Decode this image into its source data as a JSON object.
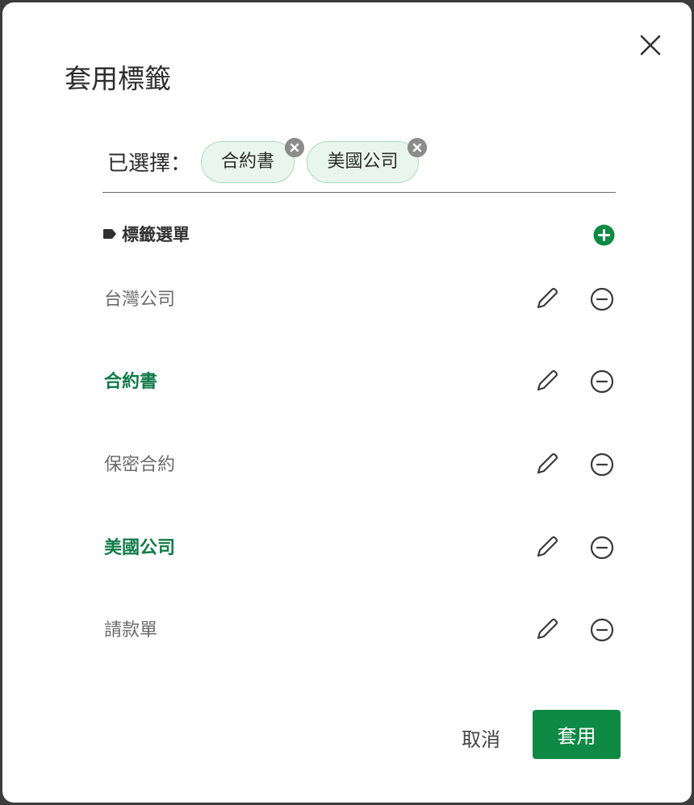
{
  "dialog": {
    "title": "套用標籤",
    "close_icon": "close-icon"
  },
  "selected": {
    "label": "已選擇：",
    "chips": [
      {
        "label": "合約書",
        "remove_icon": "close-circle-icon"
      },
      {
        "label": "美國公司",
        "remove_icon": "close-circle-icon"
      }
    ]
  },
  "menu": {
    "header_icon": "tag-icon",
    "header_label": "標籤選單",
    "add_icon": "plus-circle-icon",
    "items": [
      {
        "label": "台灣公司",
        "selected": false
      },
      {
        "label": "合約書",
        "selected": true
      },
      {
        "label": "保密合約",
        "selected": false
      },
      {
        "label": "美國公司",
        "selected": true
      },
      {
        "label": "請款單",
        "selected": false
      }
    ],
    "edit_icon": "pencil-icon",
    "remove_icon": "minus-circle-icon"
  },
  "footer": {
    "cancel_label": "取消",
    "apply_label": "套用"
  },
  "colors": {
    "accent": "#0f8a44",
    "selected_text": "#117a47",
    "chip_background": "#e9f6ee",
    "chip_border": "#a9d9b9"
  }
}
